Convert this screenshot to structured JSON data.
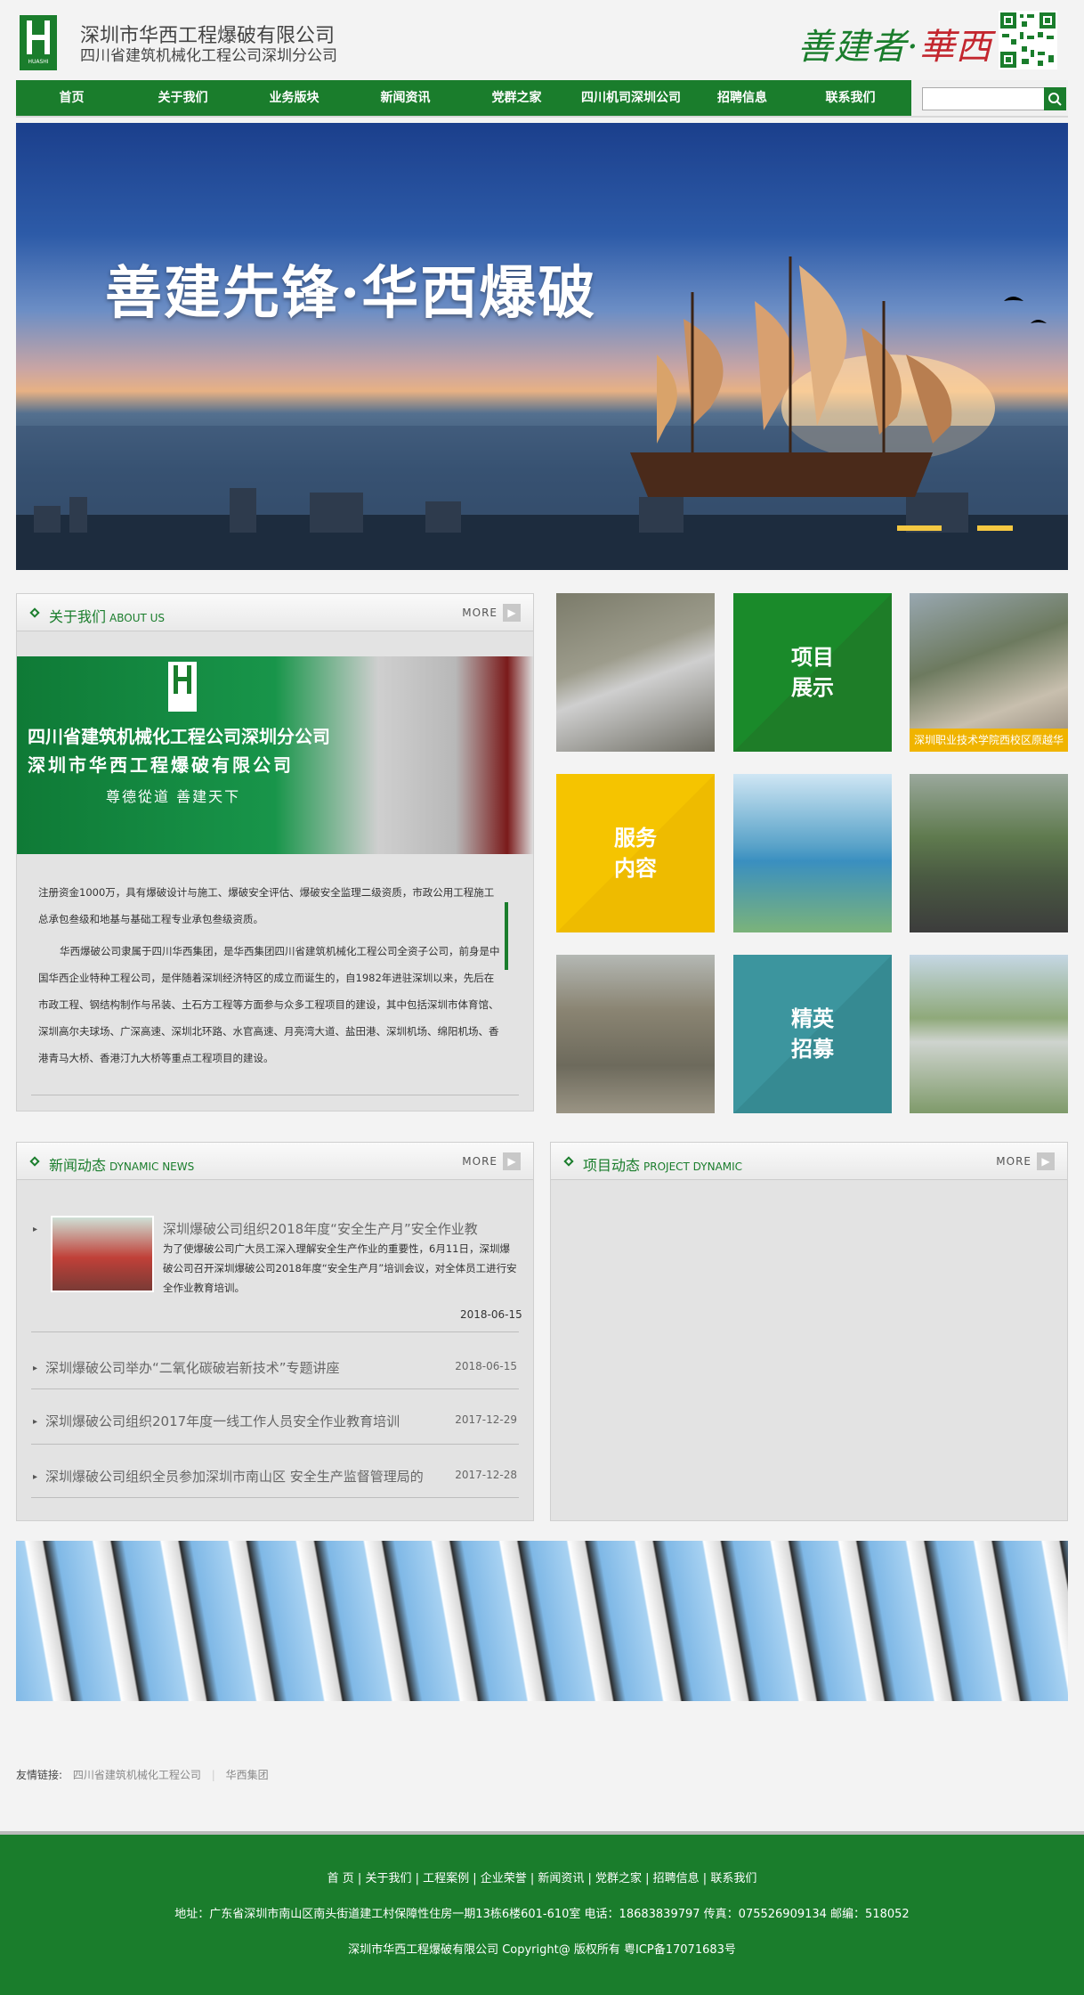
{
  "header": {
    "company_name": "深圳市华西工程爆破有限公司",
    "company_sub": "四川省建筑机械化工程公司深圳分公司",
    "logo_text": "HUASHI",
    "slogan_a": "善建者·",
    "slogan_b": "華西"
  },
  "nav": {
    "items": [
      "首页",
      "关于我们",
      "业务版块",
      "新闻资讯",
      "党群之家",
      "四川机司深圳公司",
      "招聘信息",
      "联系我们"
    ],
    "search_placeholder": ""
  },
  "banner": {
    "title": "善建先锋·华西爆破"
  },
  "about": {
    "title_cn": "关于我们",
    "title_en": "ABOUT US",
    "more": "MORE",
    "photo_line1": "四川省建筑机械化工程公司深圳分公司",
    "photo_line2": "深圳市华西工程爆破有限公司",
    "photo_line3": "尊德從道  善建天下",
    "para1": "注册资金1000万，具有爆破设计与施工、爆破安全评估、爆破安全监理二级资质，市政公用工程施工总承包叁级和地基与基础工程专业承包叁级资质。",
    "para2": "华西爆破公司隶属于四川华西集团，是华西集团四川省建筑机械化工程公司全资子公司，前身是中国华西企业特种工程公司，是伴随着深圳经济特区的成立而诞生的，自1982年进驻深圳以来，先后在市政工程、钢结构制作与吊装、土石方工程等方面参与众多工程项目的建设，其中包括深圳市体育馆、深圳高尔夫球场、广深高速、深圳北环路、水官高速、月亮湾大道、盐田港、深圳机场、绵阳机场、香港青马大桥、香港汀九大桥等重点工程项目的建设。"
  },
  "tiles": {
    "project_l1": "项目",
    "project_l2": "展示",
    "service_l1": "服务",
    "service_l2": "内容",
    "elite_l1": "精英",
    "elite_l2": "招募",
    "caption": "深圳职业技术学院西校区原越华"
  },
  "news": {
    "title_cn": "新闻动态",
    "title_en": "DYNAMIC NEWS",
    "more": "MORE",
    "featured_title": "深圳爆破公司组织2018年度“安全生产月”安全作业教",
    "featured_desc": "为了使爆破公司广大员工深入理解安全生产作业的重要性，6月11日，深圳爆破公司召开深圳爆破公司2018年度“安全生产月”培训会议，对全体员工进行安全作业教育培训。",
    "featured_date": "2018-06-15",
    "items": [
      {
        "title": "深圳爆破公司举办“二氧化碳破岩新技术”专题讲座",
        "date": "2018-06-15"
      },
      {
        "title": "深圳爆破公司组织2017年度一线工作人员安全作业教育培训",
        "date": "2017-12-29"
      },
      {
        "title": "深圳爆破公司组织全员参加深圳市南山区 安全生产监督管理局的",
        "date": "2017-12-28"
      }
    ]
  },
  "project": {
    "title_cn": "项目动态",
    "title_en": "PROJECT DYNAMIC",
    "more": "MORE"
  },
  "links": {
    "label": "友情链接:",
    "items": [
      "四川省建筑机械化工程公司",
      "华西集团"
    ]
  },
  "footer": {
    "nav": "首 页  |  关于我们  |  工程案例  |  企业荣誉  |  新闻资讯  |  党群之家  |  招聘信息  |  联系我们",
    "address": "地址：广东省深圳市南山区南头街道建工村保障性住房一期13栋6楼601-610室  电话：18683839797  传真：075526909134     邮编：518052",
    "copyright": "深圳市华西工程爆破有限公司 Copyright@ 版权所有     粤ICP备17071683号"
  },
  "colors": {
    "brand_green": "#1a7d2c",
    "tile_yellow": "#f0c000",
    "tile_teal": "#3b8c94",
    "accent_red": "#c3262e"
  }
}
